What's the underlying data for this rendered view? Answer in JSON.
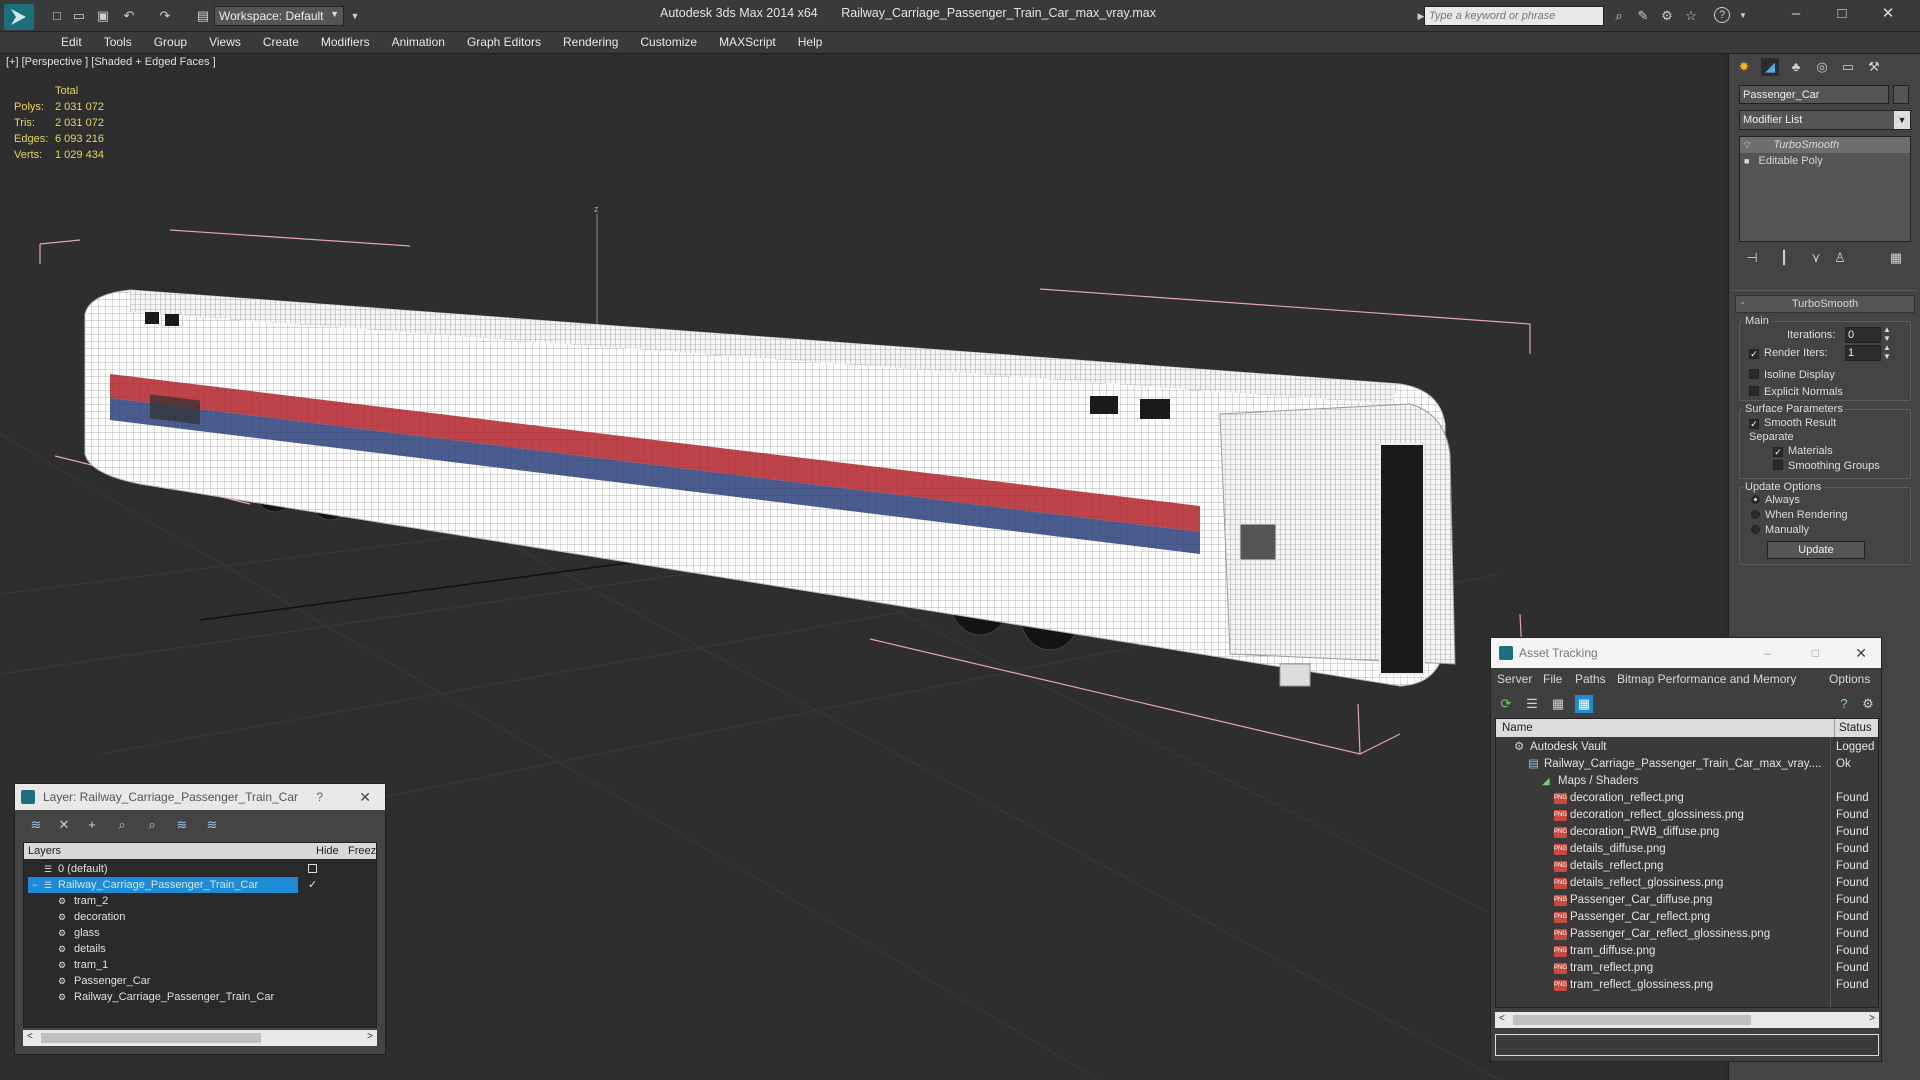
{
  "titlebar": {
    "app_title": "Autodesk 3ds Max  2014 x64",
    "file_title": "Railway_Carriage_Passenger_Train_Car_max_vray.max",
    "workspace_label": "Workspace: Default",
    "search_placeholder": "Type a keyword or phrase"
  },
  "menu": [
    "Edit",
    "Tools",
    "Group",
    "Views",
    "Create",
    "Modifiers",
    "Animation",
    "Graph Editors",
    "Rendering",
    "Customize",
    "MAXScript",
    "Help"
  ],
  "viewport": {
    "label": "[+] [Perspective ] [Shaded + Edged Faces ]",
    "stats_header": "Total",
    "stats": [
      {
        "label": "Polys:",
        "value": "2 031 072"
      },
      {
        "label": "Tris:",
        "value": "2 031 072"
      },
      {
        "label": "Edges:",
        "value": "6 093 216"
      },
      {
        "label": "Verts:",
        "value": "1 029 434"
      }
    ],
    "axis_label": "z"
  },
  "command_panel": {
    "object_name": "Passenger_Car",
    "modifier_list": "Modifier List",
    "stack": [
      "TurboSmooth",
      "Editable Poly"
    ],
    "rollout_title": "TurboSmooth",
    "main_label": "Main",
    "iterations_label": "Iterations:",
    "iterations_value": "0",
    "render_iters_label": "Render Iters:",
    "render_iters_value": "1",
    "isoline_label": "Isoline Display",
    "explicit_normals_label": "Explicit Normals",
    "surface_params_label": "Surface Parameters",
    "smooth_result_label": "Smooth Result",
    "separate_label": "Separate",
    "materials_label": "Materials",
    "smoothing_groups_label": "Smoothing Groups",
    "update_options_label": "Update Options",
    "always_label": "Always",
    "when_rendering_label": "When Rendering",
    "manually_label": "Manually",
    "update_button": "Update"
  },
  "layer_dialog": {
    "title": "Layer: Railway_Carriage_Passenger_Train_Car",
    "help": "?",
    "col_layers": "Layers",
    "col_hide": "Hide",
    "col_freeze": "Freez",
    "rows": [
      {
        "name": "0 (default)",
        "level": 0
      },
      {
        "name": "Railway_Carriage_Passenger_Train_Car",
        "level": 0
      },
      {
        "name": "tram_2",
        "level": 1
      },
      {
        "name": "decoration",
        "level": 1
      },
      {
        "name": "glass",
        "level": 1
      },
      {
        "name": "details",
        "level": 1
      },
      {
        "name": "tram_1",
        "level": 1
      },
      {
        "name": "Passenger_Car",
        "level": 1
      },
      {
        "name": "Railway_Carriage_Passenger_Train_Car",
        "level": 1
      }
    ]
  },
  "asset_dialog": {
    "title": "Asset Tracking",
    "menu": [
      "Server",
      "File",
      "Paths",
      "Bitmap Performance and Memory",
      "Options"
    ],
    "col_name": "Name",
    "col_status": "Status",
    "rows": [
      {
        "name": "Autodesk Vault",
        "status": "Logged O",
        "type": "vault"
      },
      {
        "name": "Railway_Carriage_Passenger_Train_Car_max_vray....",
        "status": "Ok",
        "type": "file"
      },
      {
        "name": "Maps / Shaders",
        "status": "",
        "type": "folder"
      },
      {
        "name": "decoration_reflect.png",
        "status": "Found",
        "type": "png"
      },
      {
        "name": "decoration_reflect_glossiness.png",
        "status": "Found",
        "type": "png"
      },
      {
        "name": "decoration_RWB_diffuse.png",
        "status": "Found",
        "type": "png"
      },
      {
        "name": "details_diffuse.png",
        "status": "Found",
        "type": "png"
      },
      {
        "name": "details_reflect.png",
        "status": "Found",
        "type": "png"
      },
      {
        "name": "details_reflect_glossiness.png",
        "status": "Found",
        "type": "png"
      },
      {
        "name": "Passenger_Car_diffuse.png",
        "status": "Found",
        "type": "png"
      },
      {
        "name": "Passenger_Car_reflect.png",
        "status": "Found",
        "type": "png"
      },
      {
        "name": "Passenger_Car_reflect_glossiness.png",
        "status": "Found",
        "type": "png"
      },
      {
        "name": "tram_diffuse.png",
        "status": "Found",
        "type": "png"
      },
      {
        "name": "tram_reflect.png",
        "status": "Found",
        "type": "png"
      },
      {
        "name": "tram_reflect_glossiness.png",
        "status": "Found",
        "type": "png"
      }
    ]
  },
  "colors": {
    "accent": "#1e8bd6",
    "stats_yellow": "#e8d45a",
    "bbox_pink": "#e8a0c0"
  }
}
